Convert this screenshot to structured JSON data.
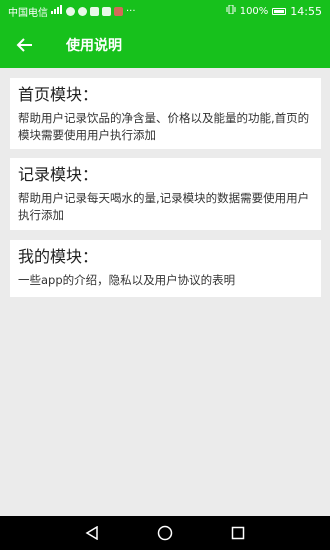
{
  "status_bar": {
    "carrier": "中国电信",
    "battery": "100%",
    "time": "14:55"
  },
  "app_bar": {
    "title": "使用说明",
    "back_icon": "arrow-left-icon"
  },
  "sections": [
    {
      "title": "首页模块：",
      "body": "帮助用户记录饮品的净含量、价格以及能量的功能,首页的模块需要使用用户执行添加"
    },
    {
      "title": "记录模块：",
      "body": "帮助用户记录每天喝水的量,记录模块的数据需要使用用户执行添加"
    },
    {
      "title": "我的模块：",
      "body": "一些app的介绍，隐私以及用户协议的表明"
    }
  ],
  "colors": {
    "accent": "#17c11c",
    "background": "#ebebeb"
  },
  "nav_bar": {
    "back": "triangle-back-icon",
    "home": "circle-home-icon",
    "recent": "square-recent-icon"
  }
}
